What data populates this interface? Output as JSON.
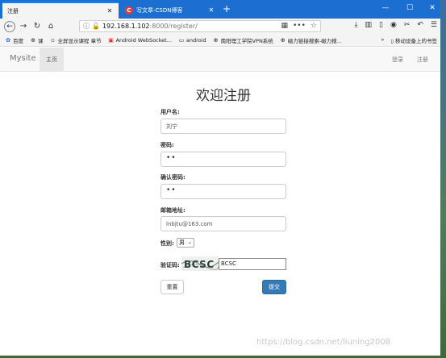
{
  "browser": {
    "tabs": [
      {
        "label": "注册"
      },
      {
        "label": "写文章-CSDN博客"
      }
    ],
    "url_host": "192.168.1.102",
    "url_path": ":8000/register/",
    "bookmarks": [
      {
        "label": "百度"
      },
      {
        "label": "课"
      },
      {
        "label": "全屏显示课程 章节"
      },
      {
        "label": "Android WebSocket..."
      },
      {
        "label": "android"
      },
      {
        "label": "南阳理工学院VPN系统"
      },
      {
        "label": "磁力链接搜索-磁力搜..."
      }
    ],
    "mobile_bookmarks": "移动设备上的书签"
  },
  "site": {
    "brand": "Mysite",
    "home": "主页",
    "login": "登录",
    "register": "注册"
  },
  "form": {
    "title": "欢迎注册",
    "username_label": "用户名:",
    "username_value": "刘宁",
    "password_label": "密码:",
    "password_value": "••",
    "confirm_label": "确认密码:",
    "confirm_value": "••",
    "email_label": "邮箱地址:",
    "email_value": "lnbjtu@163.com",
    "gender_label": "性别:",
    "gender_value": "男",
    "captcha_label": "验证码:",
    "captcha_image_text": "BCSC",
    "captcha_value": "BCSC",
    "reset_label": "重置",
    "submit_label": "提交"
  },
  "watermark": "https://blog.csdn.net/liuning2008",
  "colors": {
    "titlebar": "#1c6fd1",
    "primary_button": "#337ab7"
  }
}
